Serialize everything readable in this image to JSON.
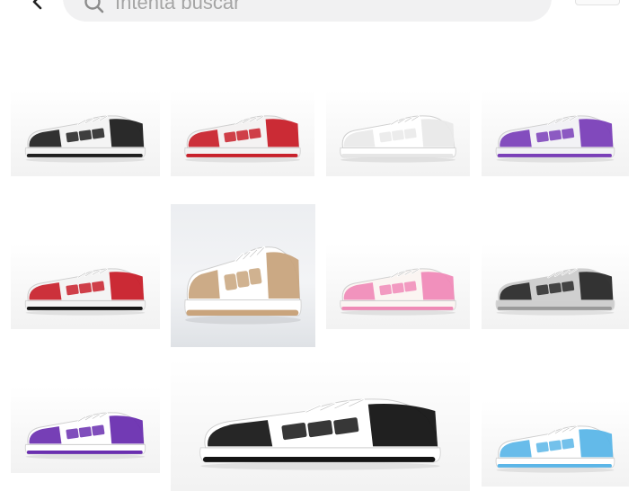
{
  "search": {
    "placeholder": "Intenta buscar"
  },
  "icons": {
    "back": "chevron-left-icon",
    "search": "search-icon",
    "menu": "more-icon"
  },
  "products": [
    {
      "name": "sneaker-black-white",
      "accent": "#1f1f1f",
      "sole": "#1f1f1f",
      "base": "#f4f4f4"
    },
    {
      "name": "sneaker-red-white",
      "accent": "#c8202a",
      "sole": "#c8202a",
      "base": "#f4f2f2"
    },
    {
      "name": "sneaker-all-white",
      "accent": "#e9e9e9",
      "sole": "#e6e6e6",
      "base": "#ffffff"
    },
    {
      "name": "sneaker-purple-white",
      "accent": "#7a3fb8",
      "sole": "#7a3fb8",
      "base": "#f2f2f5"
    },
    {
      "name": "sneaker-red-black-white",
      "accent": "#c81f2a",
      "sole": "#151515",
      "base": "#f4f4f4"
    },
    {
      "name": "sneaker-tan-white",
      "accent": "#c8a47d",
      "sole": "#c9a47c",
      "base": "#ffffff"
    },
    {
      "name": "sneaker-pink-white",
      "accent": "#f08ab8",
      "sole": "#ef8ab6",
      "base": "#fbf5f2"
    },
    {
      "name": "sneaker-grey-black",
      "accent": "#2a2a2a",
      "sole": "#9a9a9a",
      "base": "#cfcfcf"
    },
    {
      "name": "sneaker-purple-white-2",
      "accent": "#6a2fb0",
      "sole": "#6a2fb0",
      "base": "#ffffff"
    },
    {
      "name": "sneaker-black-white-large",
      "accent": "#141414",
      "sole": "#141414",
      "base": "#ffffff"
    },
    {
      "name": "sneaker-blue-white",
      "accent": "#5bb6e8",
      "sole": "#5bb6e8",
      "base": "#ffffff"
    }
  ]
}
